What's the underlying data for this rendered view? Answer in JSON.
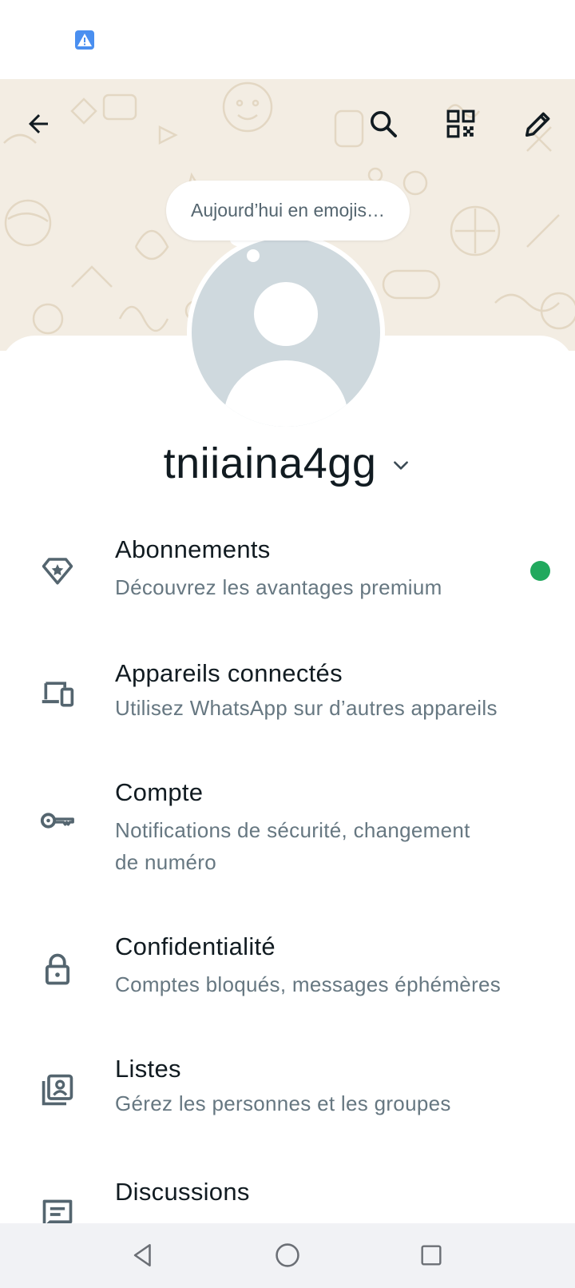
{
  "status_bar": {
    "icon": "warning-icon"
  },
  "header": {
    "back_icon": "arrow-left-icon",
    "search_icon": "search-icon",
    "qr_icon": "qr-code-icon",
    "edit_icon": "pencil-icon"
  },
  "profile": {
    "status_bubble": "Aujourd’hui en emojis…",
    "name": "tniiaina4gg",
    "name_dropdown_icon": "chevron-down-icon"
  },
  "menu": [
    {
      "icon": "diamond-star-icon",
      "title": "Abonnements",
      "subtitle": "Découvrez les avantages premium",
      "badge": true
    },
    {
      "icon": "devices-icon",
      "title": "Appareils connectés",
      "subtitle": "Utilisez WhatsApp sur d’autres appareils"
    },
    {
      "icon": "key-icon",
      "title": "Compte",
      "subtitle_line1": "Notifications de sécurité, changement",
      "subtitle_line2": "de numéro"
    },
    {
      "icon": "lock-icon",
      "title": "Confidentialité",
      "subtitle": "Comptes bloqués, messages éphémères"
    },
    {
      "icon": "contact-list-icon",
      "title": "Listes",
      "subtitle": "Gérez les personnes et les groupes"
    },
    {
      "icon": "chat-icon",
      "title": "Discussions"
    }
  ],
  "colors": {
    "accent": "#21a95e",
    "banner": "#f3ede3",
    "text": "#111b21",
    "subtext": "#667781"
  },
  "nav": {
    "back": "triangle-back-icon",
    "home": "circle-home-icon",
    "recents": "square-recents-icon"
  }
}
